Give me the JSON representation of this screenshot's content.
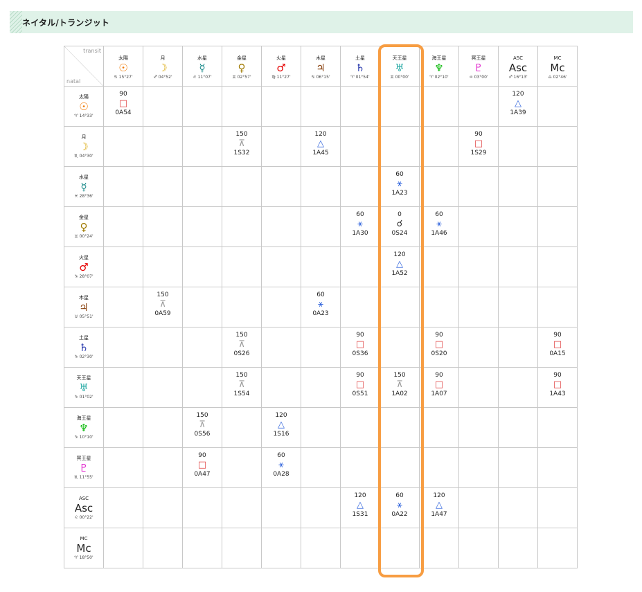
{
  "header": {
    "title": "ネイタル/トランジット"
  },
  "corner": {
    "transit": "transit",
    "natal": "natal"
  },
  "planet_colors": {
    "sun": "#f07800",
    "moon": "#d9a500",
    "mercury": "#1a8a8a",
    "venus": "#a07a00",
    "mars": "#e60000",
    "jupiter": "#8b4513",
    "saturn": "#2233aa",
    "uranus": "#1aa5a0",
    "neptune": "#11bb11",
    "pluto": "#e022cc",
    "asc": "#222222",
    "mc": "#222222"
  },
  "transit_columns": [
    {
      "id": "sun",
      "name": "太陽",
      "glyph": "☉",
      "position": "♋ 15°27'"
    },
    {
      "id": "moon",
      "name": "月",
      "glyph": "☽",
      "position": "♐ 04°52'"
    },
    {
      "id": "mercury",
      "name": "水星",
      "glyph": "☿",
      "position": "♌ 11°07'"
    },
    {
      "id": "venus",
      "name": "金星",
      "glyph": "♀",
      "position": "♊ 02°57'"
    },
    {
      "id": "mars",
      "name": "火星",
      "glyph": "♂",
      "position": "♍ 11°27'"
    },
    {
      "id": "jupiter",
      "name": "木星",
      "glyph": "♃",
      "position": "♋ 06°15'"
    },
    {
      "id": "saturn",
      "name": "土星",
      "glyph": "♄",
      "position": "♈ 01°54'"
    },
    {
      "id": "uranus",
      "name": "天王星",
      "glyph": "♅",
      "position": "♊ 00°00'"
    },
    {
      "id": "neptune",
      "name": "海王星",
      "glyph": "♆",
      "position": "♈ 02°10'"
    },
    {
      "id": "pluto",
      "name": "冥王星",
      "glyph": "♇",
      "position": "♒ 03°00'"
    },
    {
      "id": "asc",
      "name": "ASC",
      "glyph": "Asc",
      "position": "♐ 16°13'"
    },
    {
      "id": "mc",
      "name": "MC",
      "glyph": "Mc",
      "position": "♎ 02°46'"
    }
  ],
  "natal_rows": [
    {
      "id": "sun",
      "name": "太陽",
      "glyph": "☉",
      "position": "♈ 14°33'",
      "aspects": [
        {
          "col": 0,
          "angle": "90",
          "symbol": "□",
          "type": "square",
          "orb": "0A54"
        },
        {
          "col": 10,
          "angle": "120",
          "symbol": "△",
          "type": "trine",
          "orb": "1A39"
        }
      ]
    },
    {
      "id": "moon",
      "name": "月",
      "glyph": "☽",
      "position": "♏ 04°30'",
      "aspects": [
        {
          "col": 3,
          "angle": "150",
          "symbol": "⊼",
          "type": "quincunx",
          "orb": "1S32"
        },
        {
          "col": 5,
          "angle": "120",
          "symbol": "△",
          "type": "trine",
          "orb": "1A45"
        },
        {
          "col": 9,
          "angle": "90",
          "symbol": "□",
          "type": "square",
          "orb": "1S29"
        }
      ]
    },
    {
      "id": "mercury",
      "name": "水星",
      "glyph": "☿",
      "position": "♓ 28°36'",
      "aspects": [
        {
          "col": 7,
          "angle": "60",
          "symbol": "⚹",
          "type": "sextile",
          "orb": "1A23"
        }
      ]
    },
    {
      "id": "venus",
      "name": "金星",
      "glyph": "♀",
      "position": "♊ 00°24'",
      "aspects": [
        {
          "col": 6,
          "angle": "60",
          "symbol": "⚹",
          "type": "sextile",
          "orb": "1A30"
        },
        {
          "col": 7,
          "angle": "0",
          "symbol": "☌",
          "type": "conj",
          "orb": "0S24"
        },
        {
          "col": 8,
          "angle": "60",
          "symbol": "⚹",
          "type": "sextile",
          "orb": "1A46"
        }
      ]
    },
    {
      "id": "mars",
      "name": "火星",
      "glyph": "♂",
      "position": "♑ 28°07'",
      "aspects": [
        {
          "col": 7,
          "angle": "120",
          "symbol": "△",
          "type": "trine",
          "orb": "1A52"
        }
      ]
    },
    {
      "id": "jupiter",
      "name": "木星",
      "glyph": "♃",
      "position": "♉ 05°51'",
      "aspects": [
        {
          "col": 1,
          "angle": "150",
          "symbol": "⊼",
          "type": "quincunx",
          "orb": "0A59"
        },
        {
          "col": 5,
          "angle": "60",
          "symbol": "⚹",
          "type": "sextile",
          "orb": "0A23"
        }
      ]
    },
    {
      "id": "saturn",
      "name": "土星",
      "glyph": "♄",
      "position": "♑ 02°30'",
      "aspects": [
        {
          "col": 3,
          "angle": "150",
          "symbol": "⊼",
          "type": "quincunx",
          "orb": "0S26"
        },
        {
          "col": 6,
          "angle": "90",
          "symbol": "□",
          "type": "square",
          "orb": "0S36"
        },
        {
          "col": 8,
          "angle": "90",
          "symbol": "□",
          "type": "square",
          "orb": "0S20"
        },
        {
          "col": 11,
          "angle": "90",
          "symbol": "□",
          "type": "square",
          "orb": "0A15"
        }
      ]
    },
    {
      "id": "uranus",
      "name": "天王星",
      "glyph": "♅",
      "position": "♑ 01°02'",
      "aspects": [
        {
          "col": 3,
          "angle": "150",
          "symbol": "⊼",
          "type": "quincunx",
          "orb": "1S54"
        },
        {
          "col": 6,
          "angle": "90",
          "symbol": "□",
          "type": "square",
          "orb": "0S51"
        },
        {
          "col": 7,
          "angle": "150",
          "symbol": "⊼",
          "type": "quincunx",
          "orb": "1A02"
        },
        {
          "col": 8,
          "angle": "90",
          "symbol": "□",
          "type": "square",
          "orb": "1A07"
        },
        {
          "col": 11,
          "angle": "90",
          "symbol": "□",
          "type": "square",
          "orb": "1A43"
        }
      ]
    },
    {
      "id": "neptune",
      "name": "海王星",
      "glyph": "♆",
      "position": "♑ 10°10'",
      "aspects": [
        {
          "col": 2,
          "angle": "150",
          "symbol": "⊼",
          "type": "quincunx",
          "orb": "0S56"
        },
        {
          "col": 4,
          "angle": "120",
          "symbol": "△",
          "type": "trine",
          "orb": "1S16"
        }
      ]
    },
    {
      "id": "pluto",
      "name": "冥王星",
      "glyph": "♇",
      "position": "♏ 11°55'",
      "aspects": [
        {
          "col": 2,
          "angle": "90",
          "symbol": "□",
          "type": "square",
          "orb": "0A47"
        },
        {
          "col": 4,
          "angle": "60",
          "symbol": "⚹",
          "type": "sextile",
          "orb": "0A28"
        }
      ]
    },
    {
      "id": "asc",
      "name": "ASC",
      "glyph": "Asc",
      "position": "♌ 00°22'",
      "aspects": [
        {
          "col": 6,
          "angle": "120",
          "symbol": "△",
          "type": "trine",
          "orb": "1S31"
        },
        {
          "col": 7,
          "angle": "60",
          "symbol": "⚹",
          "type": "sextile",
          "orb": "0A22"
        },
        {
          "col": 8,
          "angle": "120",
          "symbol": "△",
          "type": "trine",
          "orb": "1A47"
        }
      ]
    },
    {
      "id": "mc",
      "name": "MC",
      "glyph": "Mc",
      "position": "♈ 18°50'",
      "aspects": []
    }
  ]
}
